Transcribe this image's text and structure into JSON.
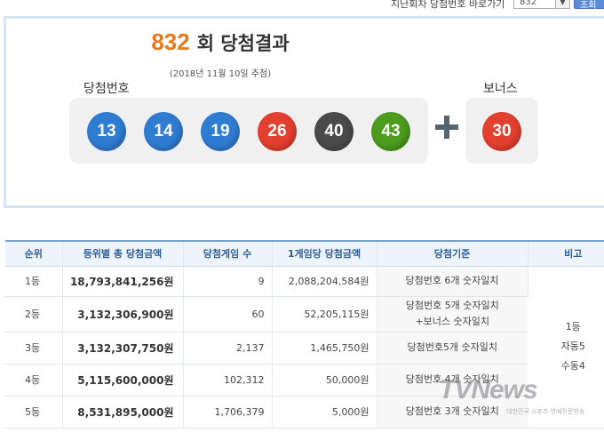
{
  "topbar": {
    "shortcut_label": "지난회차 당첨번호 바로가기",
    "round_select_value": "832",
    "go_label": "조회"
  },
  "result": {
    "round_number": "832",
    "title_suffix": "회 당첨결과",
    "draw_date": "(2018년 11월 10일 추첨)",
    "winning_label": "당첨번호",
    "bonus_label": "보너스",
    "numbers": [
      {
        "value": "13",
        "color": "#2f7dd3"
      },
      {
        "value": "14",
        "color": "#2f7dd3"
      },
      {
        "value": "19",
        "color": "#2f7dd3"
      },
      {
        "value": "26",
        "color": "#e4402f"
      },
      {
        "value": "40",
        "color": "#4a4a4a"
      },
      {
        "value": "43",
        "color": "#4c9c1e"
      }
    ],
    "bonus": {
      "value": "30",
      "color": "#e4402f"
    }
  },
  "table": {
    "headers": [
      "순위",
      "등위별 총 당첨금액",
      "당첨게임 수",
      "1게임당 당첨금액",
      "당첨기준",
      "비고"
    ],
    "rows": [
      {
        "rank": "1등",
        "total": "18,793,841,256원",
        "games": "9",
        "per_game": "2,088,204,584원",
        "match_line1": "당첨번호 6개 숫자일치",
        "match_line2": ""
      },
      {
        "rank": "2등",
        "total": "3,132,306,900원",
        "games": "60",
        "per_game": "52,205,115원",
        "match_line1": "당첨번호 5개 숫자일치",
        "match_line2": "+보너스 숫자일치"
      },
      {
        "rank": "3등",
        "total": "3,132,307,750원",
        "games": "2,137",
        "per_game": "1,465,750원",
        "match_line1": "당첨번호5개 숫자일치",
        "match_line2": ""
      },
      {
        "rank": "4등",
        "total": "5,115,600,000원",
        "games": "102,312",
        "per_game": "50,000원",
        "match_line1": "당첨번호 4개 숫자일치",
        "match_line2": ""
      },
      {
        "rank": "5등",
        "total": "8,531,895,000원",
        "games": "1,706,379",
        "per_game": "5,000원",
        "match_line1": "당첨번호 3개 숫자일치",
        "match_line2": ""
      }
    ],
    "note_lines": [
      "1등",
      "자동5",
      "수동4"
    ]
  },
  "watermark": {
    "logo": "TVNews",
    "sub": "대한민국 스포츠·연예전문방송"
  }
}
